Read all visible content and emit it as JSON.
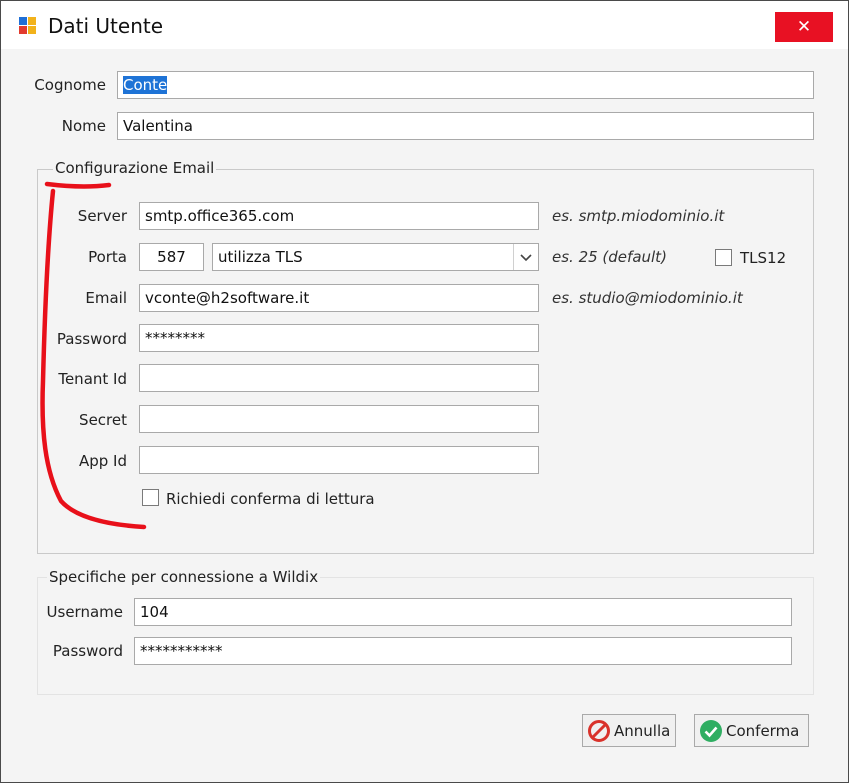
{
  "window": {
    "title": "Dati Utente",
    "close_glyph": "✕"
  },
  "fields": {
    "cognome_label": "Cognome",
    "cognome_value": "Conte",
    "nome_label": "Nome",
    "nome_value": "Valentina"
  },
  "email_group": {
    "legend": "Configurazione Email",
    "server_label": "Server",
    "server_value": "smtp.office365.com",
    "server_hint": "es. smtp.miodominio.it",
    "porta_label": "Porta",
    "porta_value": "587",
    "security_value": "utilizza TLS",
    "porta_hint": "es. 25 (default)",
    "tls12_label": "TLS12",
    "email_label": "Email",
    "email_value": "vconte@h2software.it",
    "email_hint": "es. studio@miodominio.it",
    "password_label": "Password",
    "password_value": "********",
    "tenant_label": "Tenant Id",
    "tenant_value": "",
    "secret_label": "Secret",
    "secret_value": "",
    "appid_label": "App Id",
    "appid_value": "",
    "read_receipt_label": "Richiedi conferma di lettura"
  },
  "wildix_group": {
    "legend": "Specifiche per connessione a Wildix",
    "username_label": "Username",
    "username_value": "104",
    "password_label": "Password",
    "password_value": "***********"
  },
  "buttons": {
    "cancel_label": "Annulla",
    "confirm_label": "Conferma"
  },
  "colors": {
    "close_red": "#e81123",
    "selection_blue": "#1e73d6",
    "annotation_red": "#e8101a",
    "cancel_icon": "#d9322b",
    "confirm_icon": "#2fae62"
  },
  "icons": {
    "app": "app-window-icon",
    "close": "close-icon",
    "dropdown": "chevron-down-icon",
    "cancel": "cancel-icon",
    "confirm": "check-icon"
  }
}
